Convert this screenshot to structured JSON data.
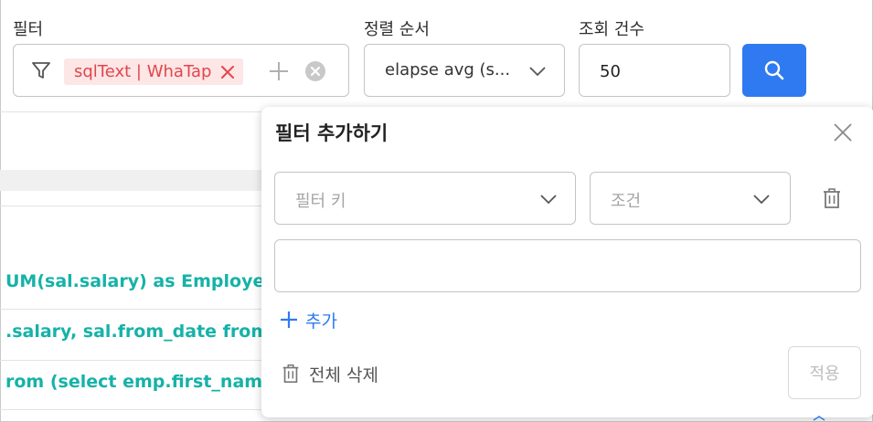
{
  "toolbar": {
    "filter_label": "필터",
    "sort_label": "정렬 순서",
    "count_label": "조회 건수",
    "filter_chip": "sqlText | WhaTap",
    "sort_value": "elapse avg (s...",
    "count_value": "50"
  },
  "table": {
    "rows": [
      "UM(sal.salary) as Employee",
      ".salary, sal.from_date from",
      "rom (select emp.first_nam"
    ]
  },
  "popup": {
    "title": "필터 추가하기",
    "key_placeholder": "필터 키",
    "condition_placeholder": "조건",
    "add_label": "추가",
    "delete_all_label": "전체 삭제",
    "apply_label": "적용"
  },
  "colors": {
    "accent": "#2f7af1",
    "chip_bg": "#fde6e6",
    "chip_text": "#e0474c",
    "row_text": "#16b2a8"
  }
}
